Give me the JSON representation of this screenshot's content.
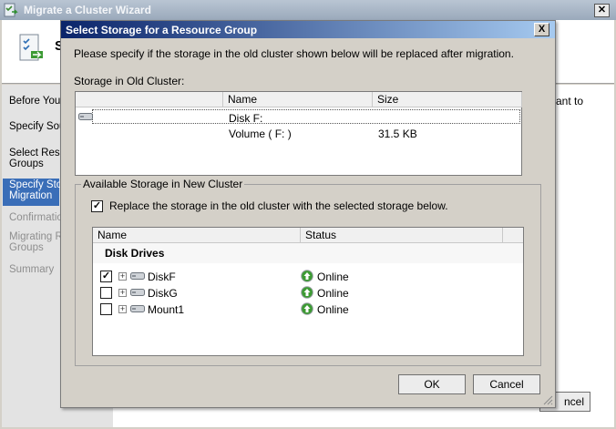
{
  "wizard": {
    "title": "Migrate a Cluster Wizard",
    "header_title": "S",
    "right_text": "ant to",
    "cancel_label": "ncel",
    "nav": [
      {
        "label": "Before You",
        "state": "normal"
      },
      {
        "label": "Specify Sou",
        "state": "normal"
      },
      {
        "label": "Select Reso",
        "label2": "Groups",
        "state": "normal"
      },
      {
        "label": "Specify Stor",
        "label2": "Migration",
        "state": "selected"
      },
      {
        "label": "Confirmation",
        "state": "disabled"
      },
      {
        "label": "Migrating Re",
        "label2": "Groups",
        "state": "disabled"
      },
      {
        "label": "Summary",
        "state": "disabled"
      }
    ]
  },
  "dialog": {
    "title": "Select Storage for a Resource Group",
    "close": "X",
    "intro": "Please specify if the storage in the old cluster shown below will be replaced after migration.",
    "old_cluster_label": "Storage in Old Cluster:",
    "old_table": {
      "columns": [
        "Name",
        "Size"
      ],
      "rows": [
        {
          "name": "Disk F:",
          "size": ""
        },
        {
          "name": "Volume ( F: )",
          "size": "31.5 KB"
        }
      ]
    },
    "new_cluster_group": "Available Storage in New Cluster",
    "replace_checkbox": {
      "label": "Replace the storage in the old cluster with the selected storage below.",
      "checked": true
    },
    "new_table": {
      "columns": [
        "Name",
        "Status"
      ],
      "group_label": "Disk Drives",
      "rows": [
        {
          "name": "DiskF",
          "status": "Online",
          "checked": true
        },
        {
          "name": "DiskG",
          "status": "Online",
          "checked": false
        },
        {
          "name": "Mount1",
          "status": "Online",
          "checked": false
        }
      ]
    },
    "ok_label": "OK",
    "cancel_label": "Cancel"
  },
  "colors": {
    "title_active": "#0a246a",
    "nav_selected": "#3a6eb8",
    "status_online": "#3c9a33"
  }
}
